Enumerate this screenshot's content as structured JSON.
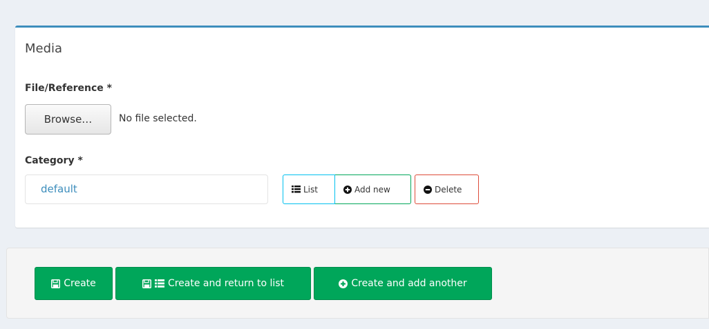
{
  "media_box": {
    "title": "Media",
    "file_label": "File/Reference *",
    "browse_label": "Browse…",
    "file_status": "No file selected.",
    "category_label": "Category *",
    "category_value": "default",
    "list_label": "List",
    "add_new_label": "Add new",
    "delete_label": "Delete"
  },
  "actions": {
    "create_label": "Create",
    "create_return_label": "Create and return to list",
    "create_another_label": "Create and add another"
  },
  "colors": {
    "accent": "#3c8dbc",
    "success": "#00a65a",
    "info": "#00c0ef",
    "danger": "#dd4b39"
  },
  "icons": {
    "list": "list-icon",
    "add": "plus-circle-icon",
    "delete": "minus-circle-icon",
    "save": "save-icon"
  }
}
